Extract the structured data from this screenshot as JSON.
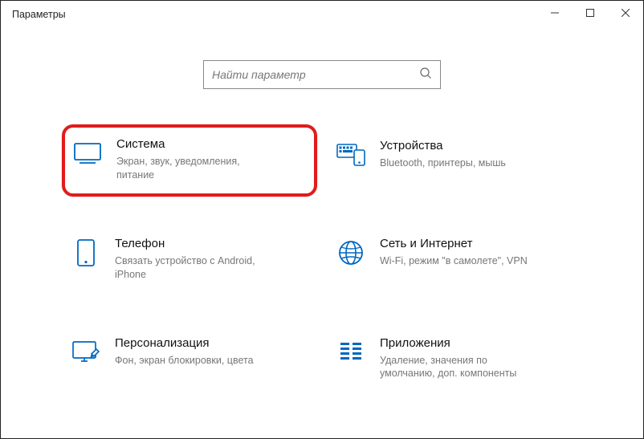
{
  "window": {
    "title": "Параметры"
  },
  "search": {
    "placeholder": "Найти параметр"
  },
  "tiles": {
    "system": {
      "title": "Система",
      "desc": "Экран, звук, уведомления, питание"
    },
    "devices": {
      "title": "Устройства",
      "desc": "Bluetooth, принтеры, мышь"
    },
    "phone": {
      "title": "Телефон",
      "desc": "Связать устройство с Android, iPhone"
    },
    "network": {
      "title": "Сеть и Интернет",
      "desc": "Wi-Fi, режим \"в самолете\", VPN"
    },
    "personal": {
      "title": "Персонализация",
      "desc": "Фон, экран блокировки, цвета"
    },
    "apps": {
      "title": "Приложения",
      "desc": "Удаление, значения по умолчанию, доп. компоненты"
    }
  }
}
